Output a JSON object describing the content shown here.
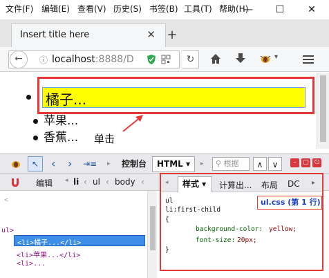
{
  "menubar": {
    "items": [
      "文件(F)",
      "编辑(E)",
      "查看(V)",
      "历史(S)",
      "书签(B)",
      "工具(T)",
      "帮助(H)"
    ]
  },
  "window_controls": {
    "minimize": "—",
    "maximize": "☐",
    "close": "✕"
  },
  "tab": {
    "title": "Insert title here",
    "close": "✕",
    "new_tab": "+"
  },
  "navbar": {
    "back": "←",
    "info": "ⓘ",
    "url_host": "localhost",
    "url_rest": ":8888/D",
    "refresh": "↻"
  },
  "page": {
    "list_items": [
      "橘子...",
      "苹果...",
      "香蕉..."
    ],
    "annotation": "单击"
  },
  "devtools": {
    "toolbar": {
      "console_tab": "控制台",
      "html_tab": "HTML ▾",
      "search_placeholder": "根据",
      "nav_back": "‹",
      "nav_fwd": "›"
    },
    "breadcrumbs": {
      "edit": "编辑",
      "items": [
        "li",
        "ul",
        "body"
      ]
    },
    "tree": {
      "lines": [
        "<",
        "",
        "ul>"
      ],
      "selected": "<li>橘子...</li>",
      "next": "<li>苹果...</li>",
      "last": "<li>..."
    },
    "side_panel": {
      "tabs": [
        "样式 ▾",
        "计算出...",
        "布局",
        "DC"
      ],
      "css_file": "ul.css (第 1 行)",
      "selector_line1": "ul",
      "selector_line2": "li:first-child",
      "open_brace": "{",
      "prop1": "background-color:",
      "val1": "yellow;",
      "prop2": "font-size:",
      "val2": "20px;",
      "close_brace": "}"
    }
  },
  "colors": {
    "highlight": "#ffff00",
    "annotation_red": "#e53935",
    "selection_blue": "#3d8ee6",
    "file_link": "#1b3fb8"
  }
}
